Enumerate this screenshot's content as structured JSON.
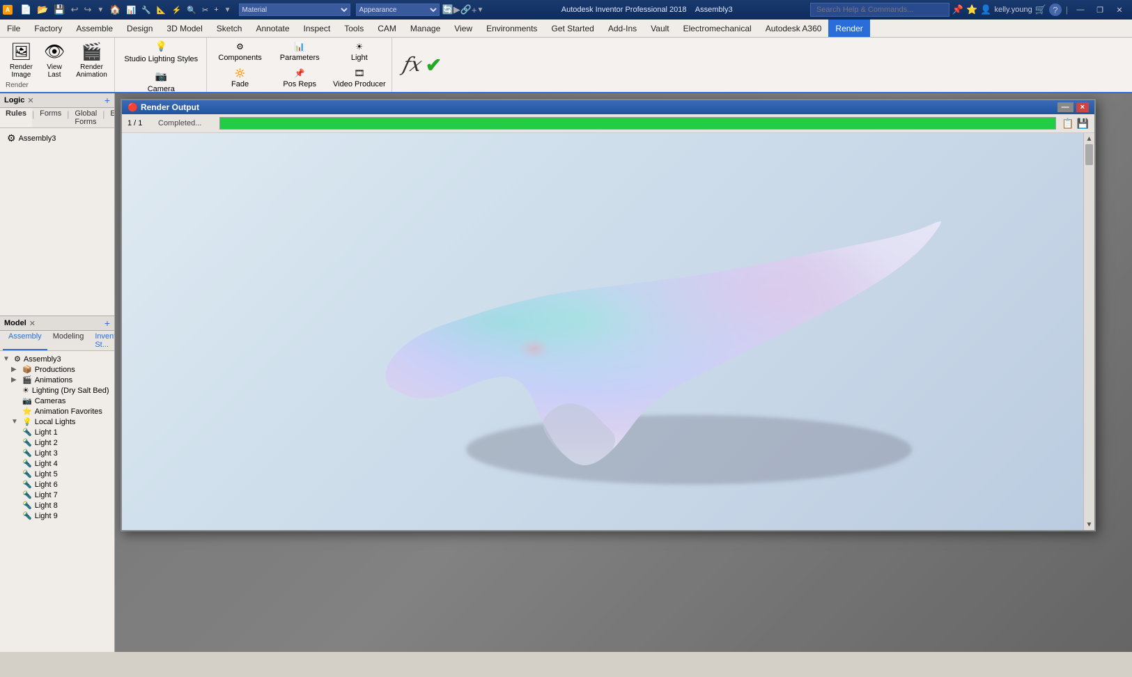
{
  "titleBar": {
    "appName": "Autodesk Inventor Professional 2018",
    "fileName": "Assembly3",
    "searchPlaceholder": "Search Help & Commands...",
    "username": "kelly.young",
    "buttons": {
      "minimize": "—",
      "maximize": "□",
      "close": "✕",
      "restore": "❐"
    }
  },
  "menuBar": {
    "items": [
      "File",
      "Factory",
      "Assemble",
      "Design",
      "3D Model",
      "Sketch",
      "Annotate",
      "Inspect",
      "Tools",
      "CAM",
      "Manage",
      "View",
      "Environments",
      "Get Started",
      "Add-Ins",
      "Vault",
      "Electromechanical",
      "Autodesk A360",
      "Render"
    ]
  },
  "ribbon": {
    "groups": [
      {
        "name": "render",
        "label": "Render",
        "buttons": [
          {
            "id": "render-image",
            "label": "Render\nImage",
            "icon": "🖼"
          },
          {
            "id": "view-last",
            "label": "View\nLast",
            "icon": "👁"
          },
          {
            "id": "render-animation",
            "label": "Render\nAnimation",
            "icon": "🎬"
          }
        ]
      },
      {
        "name": "lighting",
        "label": "",
        "small_buttons": [
          {
            "id": "studio-lighting",
            "label": "Studio Lighting Styles",
            "icon": "💡"
          },
          {
            "id": "camera",
            "label": "Camera",
            "icon": "📷"
          }
        ]
      },
      {
        "name": "appearance",
        "label": "",
        "small_buttons": [
          {
            "id": "components",
            "label": "Components",
            "icon": "⚙"
          },
          {
            "id": "parameters",
            "label": "Parameters",
            "icon": "📊"
          },
          {
            "id": "light",
            "label": "Light",
            "icon": "☀"
          },
          {
            "id": "fade",
            "label": "Fade",
            "icon": "🔆"
          },
          {
            "id": "pos-reps",
            "label": "Pos Reps",
            "icon": "📌"
          },
          {
            "id": "video-producer",
            "label": "Video Producer",
            "icon": "🎞"
          }
        ]
      }
    ],
    "formulaIcon": "fx",
    "checkIcon": "✔"
  },
  "logicPanel": {
    "title": "Logic",
    "tabs": [
      {
        "id": "rules",
        "label": "Rules"
      },
      {
        "id": "forms",
        "label": "Forms"
      },
      {
        "id": "global-forms",
        "label": "Global Forms"
      },
      {
        "id": "exte",
        "label": "Exte"
      }
    ],
    "items": [
      {
        "id": "assembly3",
        "label": "Assembly3",
        "icon": "⚙"
      }
    ]
  },
  "modelPanel": {
    "title": "Model",
    "subTabs": [
      {
        "id": "assembly",
        "label": "Assembly"
      },
      {
        "id": "modeling",
        "label": "Modeling"
      },
      {
        "id": "inventor-st",
        "label": "Inventor St..."
      }
    ],
    "treeItems": [
      {
        "id": "assembly3",
        "label": "Assembly3",
        "icon": "⚙",
        "indent": 0,
        "expand": true
      },
      {
        "id": "productions",
        "label": "Productions",
        "icon": "📦",
        "indent": 1,
        "expand": false
      },
      {
        "id": "animations",
        "label": "Animations",
        "icon": "🎬",
        "indent": 1,
        "expand": false
      },
      {
        "id": "lighting",
        "label": "Lighting (Dry Salt Bed)",
        "icon": "☀",
        "indent": 1,
        "expand": false
      },
      {
        "id": "cameras",
        "label": "Cameras",
        "icon": "📷",
        "indent": 1,
        "expand": false
      },
      {
        "id": "animation-favorites",
        "label": "Animation Favorites",
        "icon": "⭐",
        "indent": 1,
        "expand": false
      },
      {
        "id": "local-lights",
        "label": "Local Lights",
        "icon": "💡",
        "indent": 1,
        "expand": true
      },
      {
        "id": "light1",
        "label": "Light 1",
        "icon": "🔦",
        "indent": 2,
        "expand": false
      },
      {
        "id": "light2",
        "label": "Light 2",
        "icon": "🔦",
        "indent": 2,
        "expand": false
      },
      {
        "id": "light3",
        "label": "Light 3",
        "icon": "🔦",
        "indent": 2,
        "expand": false
      },
      {
        "id": "light4",
        "label": "Light 4",
        "icon": "🔦",
        "indent": 2,
        "expand": false
      },
      {
        "id": "light5",
        "label": "Light 5",
        "icon": "🔦",
        "indent": 2,
        "expand": false
      },
      {
        "id": "light6",
        "label": "Light 6",
        "icon": "🔦",
        "indent": 2,
        "expand": false
      },
      {
        "id": "light7",
        "label": "Light 7",
        "icon": "🔦",
        "indent": 2,
        "expand": false
      },
      {
        "id": "light8",
        "label": "Light 8",
        "icon": "🔦",
        "indent": 2,
        "expand": false
      },
      {
        "id": "light9",
        "label": "Light 9",
        "icon": "🔦",
        "indent": 2,
        "expand": false
      }
    ]
  },
  "renderDialog": {
    "title": "Render Output",
    "progress": {
      "fraction": "1 / 1",
      "status": "Completed...",
      "percent": 100
    },
    "closeBtn": "×",
    "minimizeBtn": "—",
    "copyBtn": "📋",
    "saveBtn": "💾"
  },
  "colors": {
    "accent": "#2a6dd8",
    "progressGreen": "#22cc22",
    "titlebarTop": "#1a3a6e",
    "titlebarBottom": "#0d2b5e"
  }
}
